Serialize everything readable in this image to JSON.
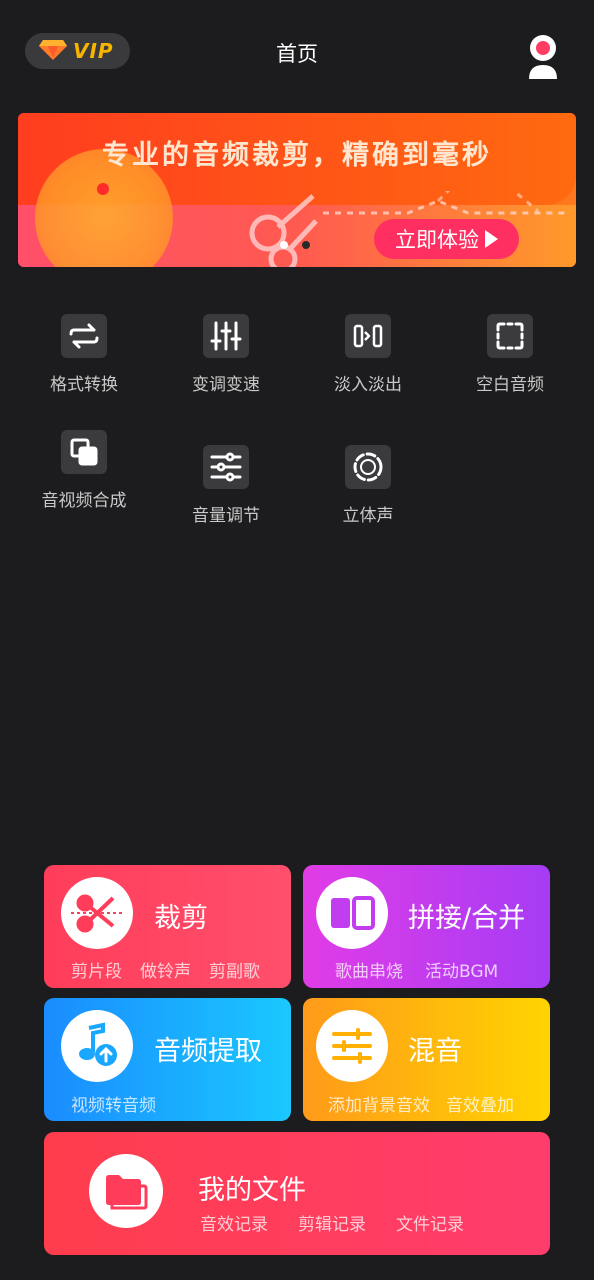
{
  "header": {
    "vip_label": "VIP",
    "title": "首页"
  },
  "banner": {
    "headline": "专业的音频裁剪，精确到毫秒",
    "cta": "立即体验",
    "page_count": 2,
    "active_page": 1
  },
  "tools": [
    {
      "label": "格式转换",
      "icon": "swap-icon"
    },
    {
      "label": "变调变速",
      "icon": "sliders-vertical-icon"
    },
    {
      "label": "淡入淡出",
      "icon": "fade-icon"
    },
    {
      "label": "空白音频",
      "icon": "dashed-square-icon"
    },
    {
      "label": "音视频合成",
      "icon": "merge-squares-icon"
    },
    {
      "label": "音量调节",
      "icon": "sliders-horizontal-icon"
    },
    {
      "label": "立体声",
      "icon": "stereo-circle-icon"
    }
  ],
  "cards": {
    "cut": {
      "title": "裁剪",
      "subs": [
        "剪片段",
        "做铃声",
        "剪副歌"
      ],
      "icon": "scissors-icon",
      "color": "#ff3d63"
    },
    "splice": {
      "title": "拼接/合并",
      "subs": [
        "歌曲串烧",
        "活动BGM"
      ],
      "icon": "split-panel-icon",
      "color": "#c23cf0"
    },
    "extract": {
      "title": "音频提取",
      "subs": [
        "视频转音频"
      ],
      "icon": "music-upload-icon",
      "color": "#1aa8ff"
    },
    "mix": {
      "title": "混音",
      "subs": [
        "添加背景音效",
        "音效叠加"
      ],
      "icon": "mixer-icon",
      "color": "#ffb800"
    },
    "files": {
      "title": "我的文件",
      "subs": [
        "音效记录",
        "剪辑记录",
        "文件记录"
      ],
      "icon": "folder-icon",
      "color": "#ff3d63"
    }
  }
}
